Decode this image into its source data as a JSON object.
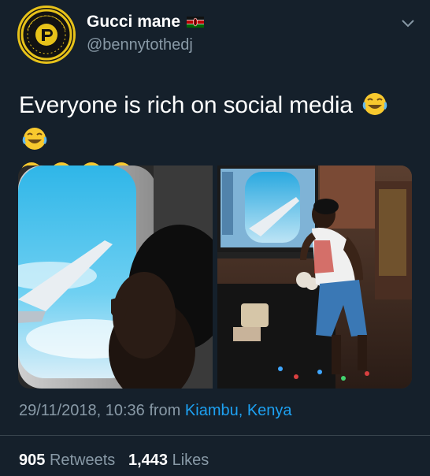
{
  "user": {
    "display_name": "Gucci mane",
    "handle": "@bennytothedj",
    "avatar_text": "DEEJAY BENNYTO"
  },
  "tweet": {
    "text": "Everyone is rich on social media",
    "emoji": "face-with-tears-of-joy",
    "timestamp": "29/11/2018, 10:36 from",
    "location": "Kiambu, Kenya"
  },
  "stats": {
    "retweets_count": "905",
    "retweets_label": "Retweets",
    "likes_count": "1,443",
    "likes_label": "Likes"
  },
  "colors": {
    "background": "#15202b",
    "secondary_text": "#8899a6",
    "link": "#1da1f2",
    "avatar_accent": "#e7c21a"
  },
  "icons": [
    "kenya-flag-icon",
    "chevron-down-icon",
    "face-with-tears-of-joy-emoji"
  ]
}
